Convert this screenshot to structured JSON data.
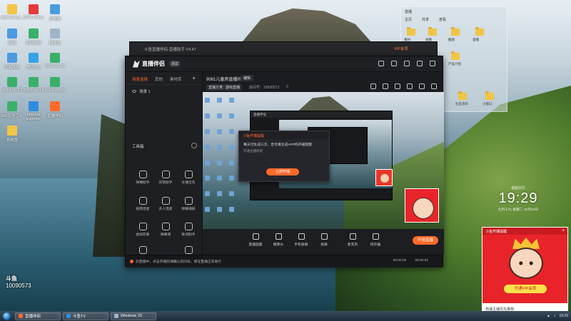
{
  "desktop": {
    "icons": [
      {
        "label": "Administrat...",
        "color": "#f2c544"
      },
      {
        "label": "WPS Office",
        "color": "#e73a3a"
      },
      {
        "label": "此电脑",
        "color": "#4b9be0"
      },
      {
        "label": "网络",
        "color": "#4b9be0"
      },
      {
        "label": "资料解析",
        "color": "#3ab06b"
      },
      {
        "label": "回收站",
        "color": "#9fb4c7"
      },
      {
        "label": "控制面板",
        "color": "#4b9be0"
      },
      {
        "label": "腾讯QQ",
        "color": "#36a3e6"
      },
      {
        "label": "2019-06-12",
        "color": "#3ab06b"
      },
      {
        "label": "2019-06-13",
        "color": "#3ab06b"
      },
      {
        "label": "2019-06-14",
        "color": "#3ab06b"
      },
      {
        "label": "2019-06-15",
        "color": "#3ab06b"
      },
      {
        "label": "360安全卫士",
        "color": "#3ab06b"
      },
      {
        "label": "Internet Explorer",
        "color": "#2e8de0"
      },
      {
        "label": "直播伴侣",
        "color": "#ff6a2b"
      },
      {
        "label": "系统盘",
        "color": "#f2c544"
      }
    ],
    "qq_name": "斗鱼",
    "qq_number": "10090573"
  },
  "explorer": {
    "title": "直播",
    "tabs": [
      "主页",
      "共享",
      "查看"
    ],
    "items": [
      "素材",
      "录像",
      "截图",
      "直播",
      "斗鱼直播",
      "产品介绍",
      "社区资料",
      "小窗口"
    ]
  },
  "app": {
    "window_title": "斗鱼直播伴侣-直播助手 V4.47",
    "vip_link": "VIP会员",
    "logo_text": "直播伴侣",
    "version_badge": "測試",
    "left_tabs": [
      "场景选择",
      "其他",
      "素材库"
    ],
    "scene_label": "场景 1",
    "tools_title": "工具箱",
    "tools": [
      "弹幕助手",
      "房管助手",
      "主播任务",
      "视频连麦",
      "多人连麦",
      "弹幕播报",
      "虚拟形象",
      "弹幕墙",
      "歌词助手",
      "美颜",
      "直播数据"
    ],
    "room_title": "9081儿童房直播间",
    "room_tag": "编辑",
    "category_1": "直播分类",
    "category_2": "游戏直播",
    "room_id": "房间号：10090573",
    "fans": "0",
    "preview": {
      "nested_title": "直播伴侣",
      "dialog_title": "斗鱼开播提醒",
      "dialog_text": "每天可生成三次，您可再生成APP码开播提醒",
      "dialog_sub": "开通主播权限",
      "dialog_button": "立即开播"
    },
    "controls": [
      "直播画面",
      "摄像头",
      "手机投屏",
      "投屏",
      "麦克风",
      "扬声器"
    ],
    "live_button": "开始直播",
    "status_text": "云直播中，点击开播前请确认房间号，保证直播正常进行",
    "time_1": "00:00:02",
    "time_2": "00:00:02"
  },
  "clock": {
    "caption": "桌面日历",
    "time": "19:29",
    "date": "九月十九 星期二 10月24日"
  },
  "vip_card": {
    "title": "斗鱼开播提醒",
    "button": "开通VIP会员",
    "footer": "热播主播优先推荐"
  },
  "taskbar": {
    "tasks": [
      "直播伴侣",
      "斗鱼TV",
      "Windows 10"
    ],
    "time": "19:29"
  },
  "colors": {
    "accent": "#ff6a2b",
    "app_bg": "#1b1c20",
    "vip_red": "#e8242a"
  }
}
